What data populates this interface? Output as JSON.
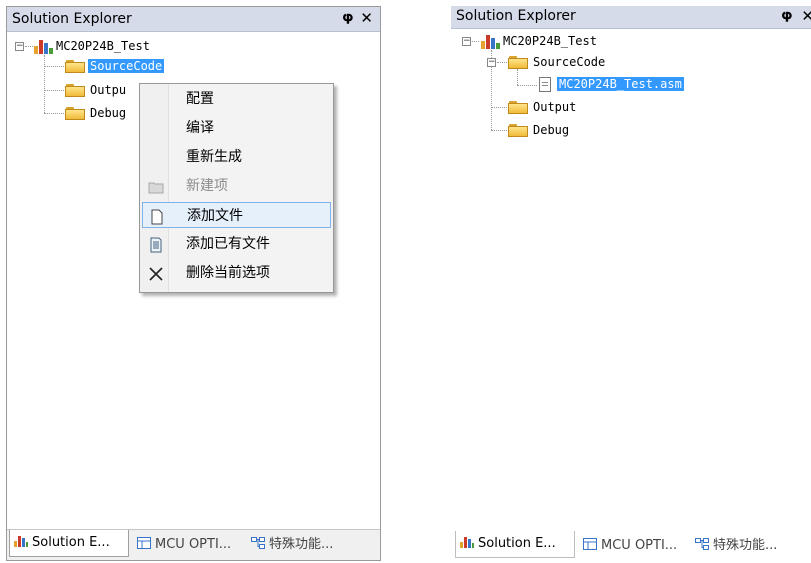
{
  "left_panel": {
    "title": "Solution Explorer",
    "pin_glyph": "ᵽ",
    "close_glyph": "✕",
    "tree": {
      "project": "MC20P24B_Test",
      "folders": [
        "SourceCode",
        "Outpu",
        "Debug"
      ]
    },
    "context_menu": {
      "items": [
        {
          "label": "配置",
          "icon": "none",
          "enabled": true
        },
        {
          "label": "编译",
          "icon": "none",
          "enabled": true
        },
        {
          "label": "重新生成",
          "icon": "none",
          "enabled": true
        },
        {
          "label": "新建项",
          "icon": "folder-icon",
          "enabled": false
        },
        {
          "label": "添加文件",
          "icon": "file-icon",
          "enabled": true
        },
        {
          "label": "添加已有文件",
          "icon": "document-icon",
          "enabled": true
        },
        {
          "label": "删除当前选项",
          "icon": "delete-x-icon",
          "enabled": true
        }
      ]
    },
    "bottom_tabs": [
      "Solution E...",
      "MCU OPTI...",
      "特殊功能..."
    ]
  },
  "right_panel": {
    "title": "Solution Explorer",
    "pin_glyph": "ᵽ",
    "close_glyph": "✕",
    "tree": {
      "project": "MC20P24B_Test",
      "folders": [
        "SourceCode",
        "Output",
        "Debug"
      ],
      "file": "MC20P24B_Test.asm"
    },
    "bottom_tabs": [
      "Solution E...",
      "MCU OPTI...",
      "特殊功能..."
    ]
  },
  "colors": {
    "selection": "#3399ff",
    "menu_hover_border": "#7eb4ea",
    "title_bar": "#d6dbe9"
  }
}
